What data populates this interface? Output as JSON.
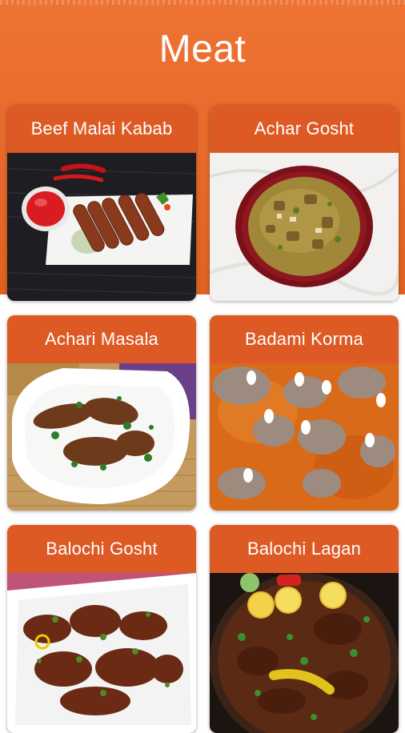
{
  "header": {
    "title": "Meat"
  },
  "recipes": [
    {
      "name": "Beef Malai Kabab"
    },
    {
      "name": "Achar Gosht"
    },
    {
      "name": "Achari Masala"
    },
    {
      "name": "Badami Korma"
    },
    {
      "name": "Balochi Gosht"
    },
    {
      "name": "Balochi Lagan"
    }
  ],
  "colors": {
    "header_bg": "#e8692a",
    "card_title_bg": "#de5a24",
    "title_text": "#ffffff"
  }
}
